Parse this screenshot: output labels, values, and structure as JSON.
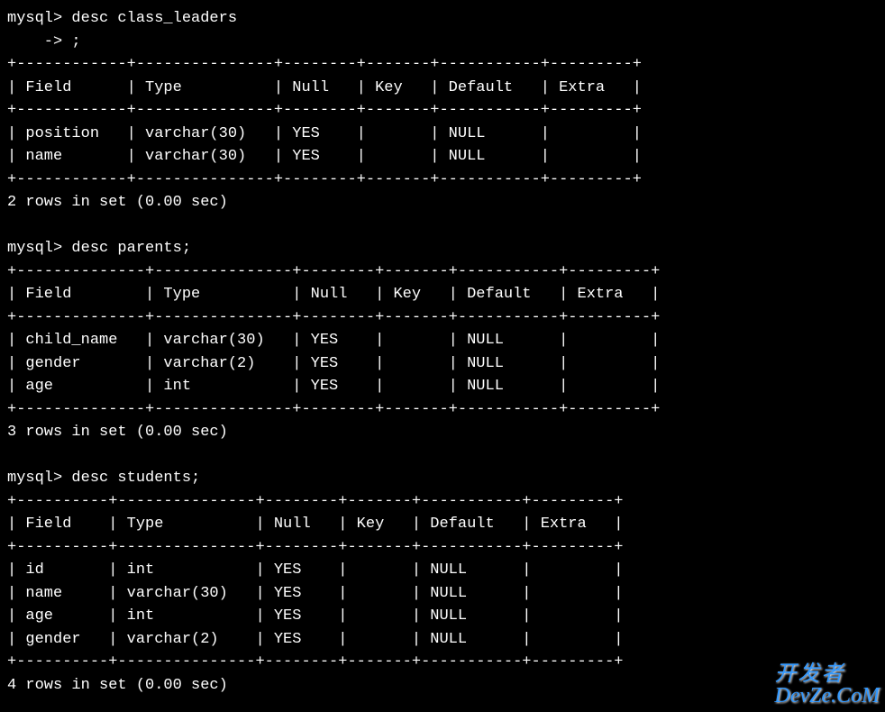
{
  "queries": [
    {
      "prompt1": "mysql> desc class_leaders",
      "prompt2": "    -> ;",
      "columns": [
        {
          "name": "Field",
          "w": 10
        },
        {
          "name": "Type",
          "w": 13
        },
        {
          "name": "Null",
          "w": 6
        },
        {
          "name": "Key",
          "w": 5
        },
        {
          "name": "Default",
          "w": 9
        },
        {
          "name": "Extra",
          "w": 7
        }
      ],
      "rows": [
        [
          "position",
          "varchar(30)",
          "YES",
          "",
          "NULL",
          ""
        ],
        [
          "name",
          "varchar(30)",
          "YES",
          "",
          "NULL",
          ""
        ]
      ],
      "footer": "2 rows in set (0.00 sec)"
    },
    {
      "prompt1": "mysql> desc parents;",
      "columns": [
        {
          "name": "Field",
          "w": 12
        },
        {
          "name": "Type",
          "w": 13
        },
        {
          "name": "Null",
          "w": 6
        },
        {
          "name": "Key",
          "w": 5
        },
        {
          "name": "Default",
          "w": 9
        },
        {
          "name": "Extra",
          "w": 7
        }
      ],
      "rows": [
        [
          "child_name",
          "varchar(30)",
          "YES",
          "",
          "NULL",
          ""
        ],
        [
          "gender",
          "varchar(2)",
          "YES",
          "",
          "NULL",
          ""
        ],
        [
          "age",
          "int",
          "YES",
          "",
          "NULL",
          ""
        ]
      ],
      "footer": "3 rows in set (0.00 sec)"
    },
    {
      "prompt1": "mysql> desc students;",
      "columns": [
        {
          "name": "Field",
          "w": 8
        },
        {
          "name": "Type",
          "w": 13
        },
        {
          "name": "Null",
          "w": 6
        },
        {
          "name": "Key",
          "w": 5
        },
        {
          "name": "Default",
          "w": 9
        },
        {
          "name": "Extra",
          "w": 7
        }
      ],
      "rows": [
        [
          "id",
          "int",
          "YES",
          "",
          "NULL",
          ""
        ],
        [
          "name",
          "varchar(30)",
          "YES",
          "",
          "NULL",
          ""
        ],
        [
          "age",
          "int",
          "YES",
          "",
          "NULL",
          ""
        ],
        [
          "gender",
          "varchar(2)",
          "YES",
          "",
          "NULL",
          ""
        ]
      ],
      "footer": "4 rows in set (0.00 sec)"
    }
  ],
  "watermark": {
    "line1": "开发者",
    "line2": "DevZe.CoM"
  }
}
